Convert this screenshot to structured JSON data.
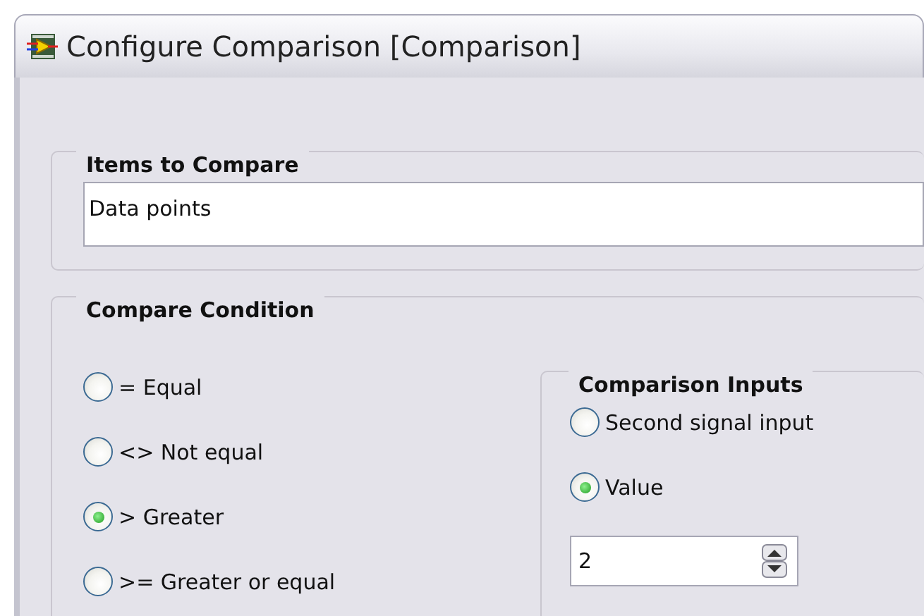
{
  "window": {
    "title": "Configure Comparison [Comparison]"
  },
  "items_to_compare": {
    "legend": "Items to Compare",
    "value": "Data points"
  },
  "compare_condition": {
    "legend": "Compare Condition",
    "options": [
      {
        "label": "= Equal",
        "selected": false
      },
      {
        "label": "<> Not equal",
        "selected": false
      },
      {
        "label": "> Greater",
        "selected": true
      },
      {
        "label": ">= Greater or equal",
        "selected": false
      }
    ]
  },
  "comparison_inputs": {
    "legend": "Comparison Inputs",
    "options": [
      {
        "label": "Second signal input",
        "selected": false
      },
      {
        "label": "Value",
        "selected": true
      }
    ],
    "value_field": {
      "value": "2"
    }
  }
}
